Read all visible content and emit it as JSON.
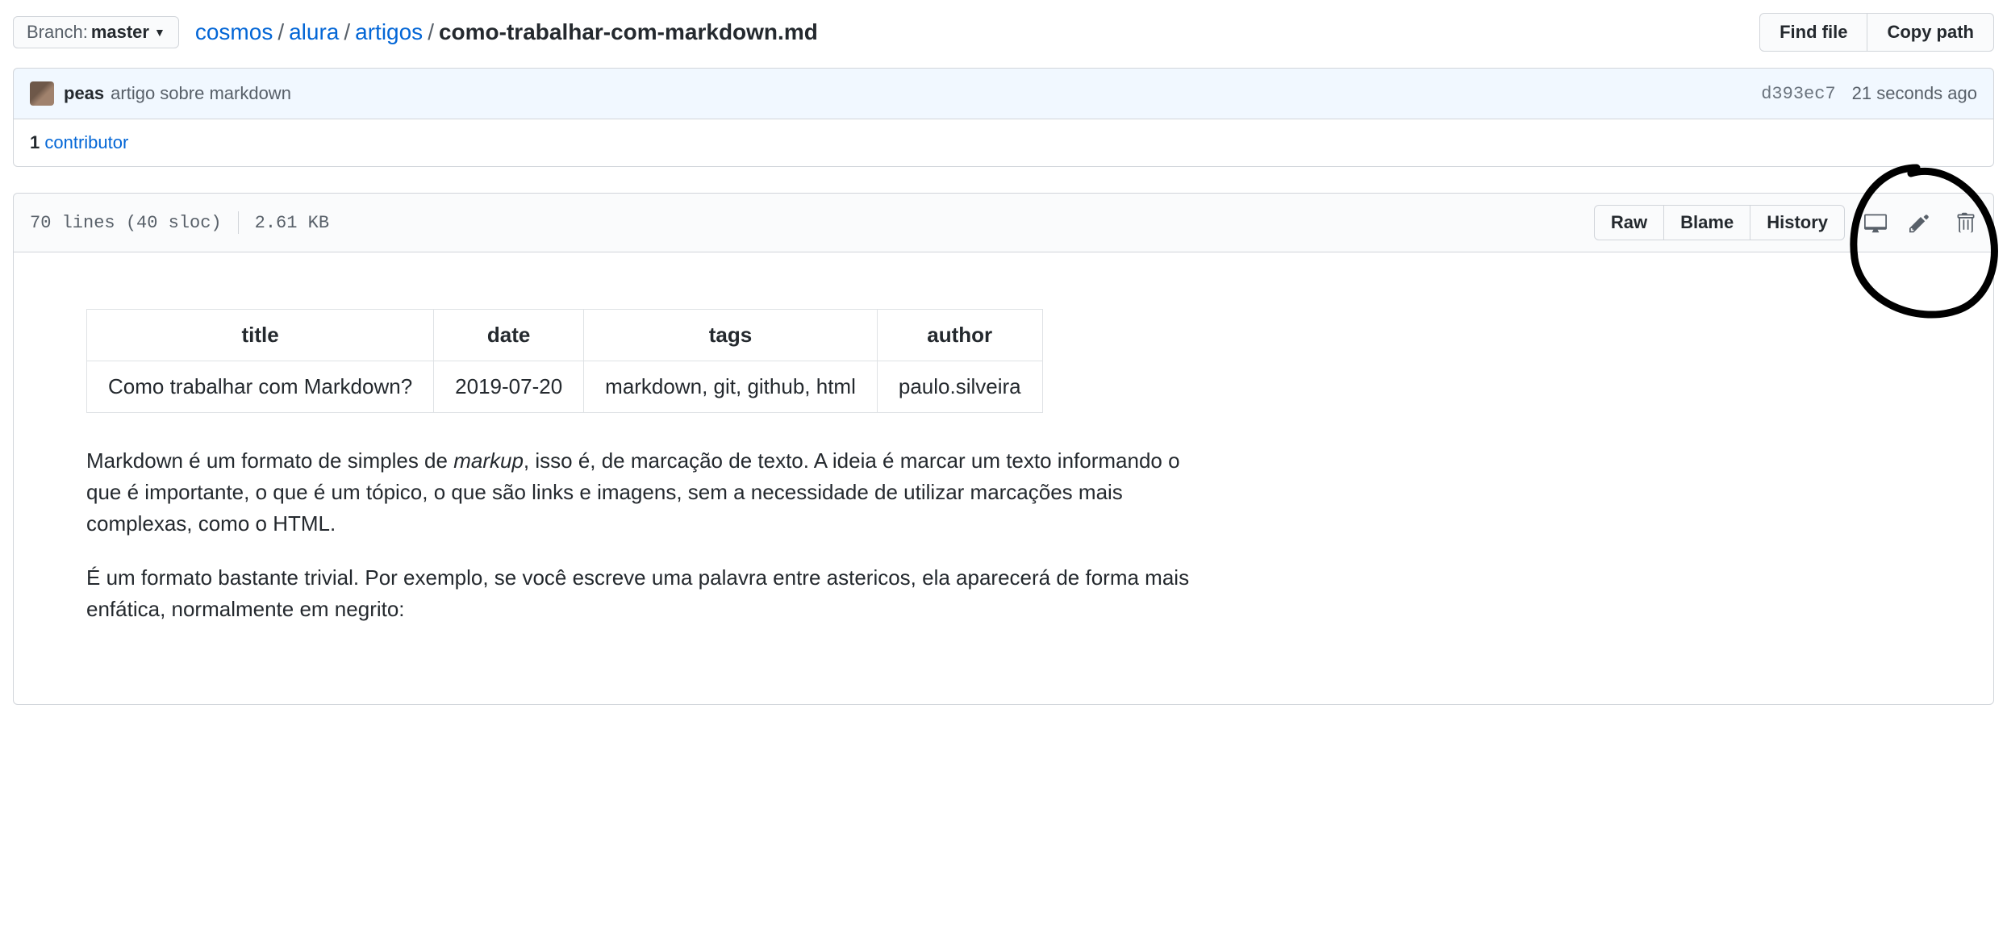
{
  "branch": {
    "prefix": "Branch:",
    "name": "master"
  },
  "breadcrumb": {
    "parts": [
      "cosmos",
      "alura",
      "artigos"
    ],
    "file": "como-trabalhar-com-markdown.md"
  },
  "topActions": {
    "findFile": "Find file",
    "copyPath": "Copy path"
  },
  "commit": {
    "author": "peas",
    "message": "artigo sobre markdown",
    "sha": "d393ec7",
    "time": "21 seconds ago"
  },
  "contributors": {
    "count": "1",
    "label": "contributor"
  },
  "fileInfo": {
    "lines": "70 lines (40 sloc)",
    "size": "2.61 KB"
  },
  "fileActions": {
    "raw": "Raw",
    "blame": "Blame",
    "history": "History"
  },
  "frontMatter": {
    "headers": [
      "title",
      "date",
      "tags",
      "author"
    ],
    "row": [
      "Como trabalhar com Markdown?",
      "2019-07-20",
      "markdown, git, github, html",
      "paulo.silveira"
    ]
  },
  "body": {
    "p1a": "Markdown é um formato de simples de ",
    "p1em": "markup",
    "p1b": ", isso é, de marcação de texto. A ideia é marcar um texto informando o que é importante, o que é um tópico, o que são links e imagens, sem a necessidade de utilizar marcações mais complexas, como o HTML.",
    "p2": "É um formato bastante trivial. Por exemplo, se você escreve uma palavra entre astericos, ela aparecerá de forma mais enfática, normalmente em negrito:"
  }
}
